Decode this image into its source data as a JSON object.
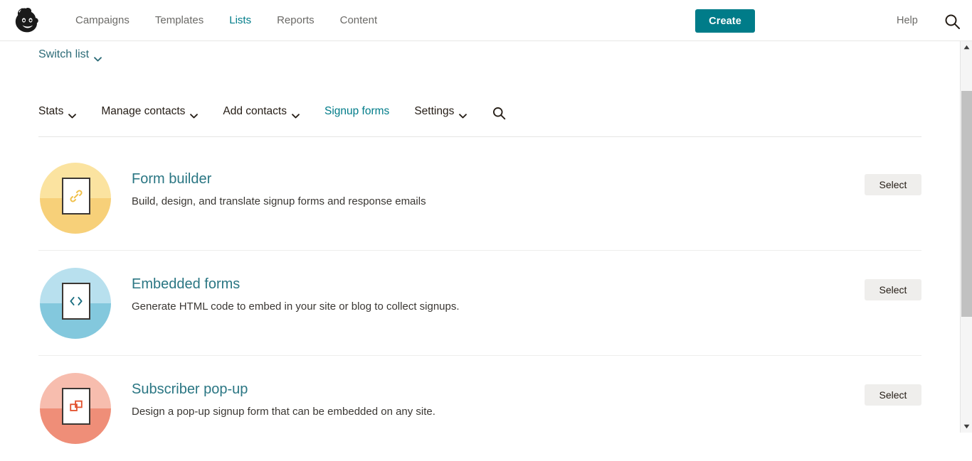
{
  "header": {
    "logo_icon": "mailchimp-freddie-logo",
    "nav": [
      {
        "label": "Campaigns",
        "active": false
      },
      {
        "label": "Templates",
        "active": false
      },
      {
        "label": "Lists",
        "active": true
      },
      {
        "label": "Reports",
        "active": false
      },
      {
        "label": "Content",
        "active": false
      }
    ],
    "create_label": "Create",
    "help_label": "Help",
    "search_icon": "search-icon",
    "ghost_text": "",
    "accent_color": "#007c89"
  },
  "switch_list": {
    "label": "Switch list",
    "caret_icon": "chevron-down-icon"
  },
  "subnav": {
    "items": [
      {
        "label": "Stats",
        "has_caret": true,
        "active": false
      },
      {
        "label": "Manage contacts",
        "has_caret": true,
        "active": false
      },
      {
        "label": "Add contacts",
        "has_caret": true,
        "active": false
      },
      {
        "label": "Signup forms",
        "has_caret": false,
        "active": true
      },
      {
        "label": "Settings",
        "has_caret": true,
        "active": false
      }
    ],
    "search_icon": "search-icon"
  },
  "rows": [
    {
      "title": "Form builder",
      "description": "Build, design, and translate signup forms and response emails",
      "button_label": "Select",
      "icon_name": "link-form-icon",
      "circle_top_color": "#fbe3a0",
      "circle_bottom_color": "#f7d079",
      "glyph_color": "#f0c04a"
    },
    {
      "title": "Embedded forms",
      "description": "Generate HTML code to embed in your site or blog to collect signups.",
      "button_label": "Select",
      "icon_name": "code-form-icon",
      "circle_top_color": "#b8e0ee",
      "circle_bottom_color": "#83c8dd",
      "glyph_color": "#1a6d80"
    },
    {
      "title": "Subscriber pop-up",
      "description": "Design a pop-up signup form that can be embedded on any site.",
      "button_label": "Select",
      "icon_name": "popup-form-icon",
      "circle_top_color": "#f7bdae",
      "circle_bottom_color": "#ef8e78",
      "glyph_color": "#e2522f"
    }
  ],
  "scrollbar": {
    "up_icon": "triangle-up-icon",
    "down_icon": "triangle-down-icon",
    "thumb_name": "scrollbar-thumb"
  }
}
